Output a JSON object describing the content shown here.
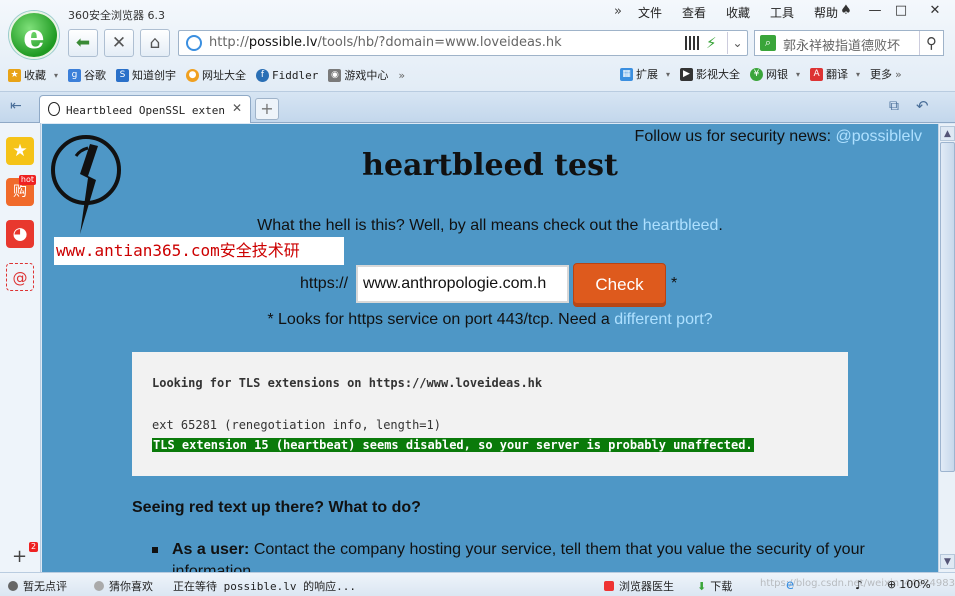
{
  "window": {
    "app_title": "360安全浏览器 6.3",
    "menu": [
      "文件",
      "查看",
      "收藏",
      "工具",
      "帮助"
    ]
  },
  "toolbar": {
    "url_prefix": "http://",
    "url_domain": "possible.lv",
    "url_path": "/tools/hb/?domain=www.loveideas.hk",
    "search_text": "郭永祥被指道德败坏"
  },
  "bookmarks": {
    "left": [
      {
        "label": "收藏",
        "icon": "star-add-icon",
        "color": "#e8a317"
      },
      {
        "label": "谷歌",
        "icon": "google-icon",
        "color": "#3b7fd9"
      },
      {
        "label": "知道创宇",
        "icon": "knownsec-icon",
        "color": "#2a70c9"
      },
      {
        "label": "网址大全",
        "icon": "site-guide-icon",
        "color": "#f0a020"
      },
      {
        "label": "Fiddler",
        "icon": "fiddler-icon",
        "color": "#2a6fb5"
      },
      {
        "label": "游戏中心",
        "icon": "gamepad-icon",
        "color": "#7a7a7a"
      }
    ],
    "right": [
      {
        "label": "扩展",
        "icon": "extensions-icon",
        "color": "#3b8fe0"
      },
      {
        "label": "影视大全",
        "icon": "video-icon",
        "color": "#333"
      },
      {
        "label": "网银",
        "icon": "bank-shield-icon",
        "color": "#3aa53a"
      },
      {
        "label": "翻译",
        "icon": "translate-icon",
        "color": "#d33"
      },
      {
        "label": "更多",
        "icon": "more-icon",
        "color": "#555"
      }
    ]
  },
  "tab": {
    "title": "Heartbleed OpenSSL extensio"
  },
  "sidebar": {
    "badge_hot": "hot",
    "badge_hot_char": "购",
    "badge_count": "2"
  },
  "page": {
    "follow_text": "Follow us for security news: ",
    "follow_handle": "@possiblelv",
    "heading": "heartbleed test",
    "intro_text": "What the hell is this? Well, by all means check out the ",
    "intro_link": "heartbleed",
    "intro_end": ".",
    "watermark": "www.antian365.com安全技术研",
    "https_label": "https://",
    "domain_value": "www.anthropologie.com.h",
    "check_label": "Check",
    "asterisk": "*",
    "port_note_text": "* Looks for https service on port 443/tcp. Need a ",
    "port_note_link": "different port?",
    "result_line1": "Looking for TLS extensions on https://www.loveideas.hk",
    "result_line2": "ext 65281 (renegotiation info, length=1)",
    "result_line3": "TLS extension 15 (heartbeat) seems disabled, so your server is probably unaffected.",
    "seeing_heading": "Seeing red text up there? What to do?",
    "bullet_strong": "As a user:",
    "bullet_text": " Contact the company hosting your service, tell them that you value the security of your information."
  },
  "statusbar": {
    "no_comment": "暂无点评",
    "guess": "猜你喜欢",
    "loading": "正在等待 possible.lv 的响应...",
    "doctor": "浏览器医生",
    "download": "下载",
    "zoom": "100%",
    "watermark_url": "https://blog.csdn.net/weixin_44924983"
  },
  "colors": {
    "page_bg": "#4e97c6",
    "link": "#aee0ff",
    "check_button": "#de5a1d",
    "result_ok": "#0a7a0a",
    "watermark_text": "#cc0000"
  }
}
